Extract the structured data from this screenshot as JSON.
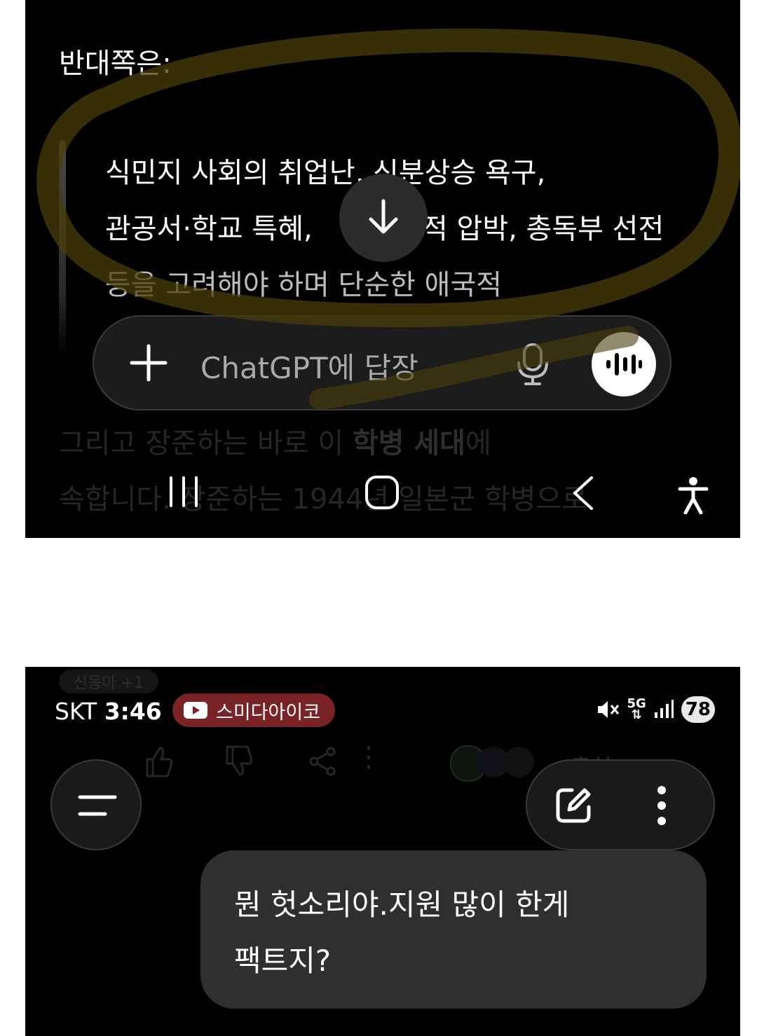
{
  "top": {
    "heading": "반대쪽은:",
    "quote_lines": [
      "식민지 사회의 취업난, 신분상승 욕구,",
      "관공서·학교 특혜, ",
      "적 압박, 총독부 선전",
      "등을 고려해야 하며 단순한 애국적"
    ],
    "composer": {
      "placeholder": "ChatGPT에 답장"
    },
    "behind_text": [
      {
        "pre": "그리고 장준하는 바로 이 ",
        "bold": "학병 세대",
        "post": "에"
      },
      {
        "pre": "속합니다. 장준하는 1944년 일본군 학병으로",
        "bold": "",
        "post": ""
      }
    ]
  },
  "bottom": {
    "status": {
      "carrier": "SKT",
      "time": "3:46",
      "notification": "스미다아이코",
      "network": "5G",
      "battery": "78"
    },
    "faint_pill": "신동아 +1",
    "ghost_label": "출처",
    "bubble_lines": [
      "뭔 헛소리야.지원 많이 한게",
      "팩트지?"
    ]
  },
  "colors": {
    "background": "#000000",
    "bubble": "#2f2f2f",
    "highlight_stroke": "#4a3d0a",
    "notification_badge": "#7a2326"
  },
  "icons": [
    "arrow-down-icon",
    "plus-icon",
    "mic-icon",
    "voice-mode-icon",
    "recent-apps-icon",
    "home-icon",
    "back-icon",
    "accessibility-icon",
    "mute-icon",
    "signal-icon",
    "menu-icon",
    "edit-icon",
    "more-vert-icon"
  ]
}
